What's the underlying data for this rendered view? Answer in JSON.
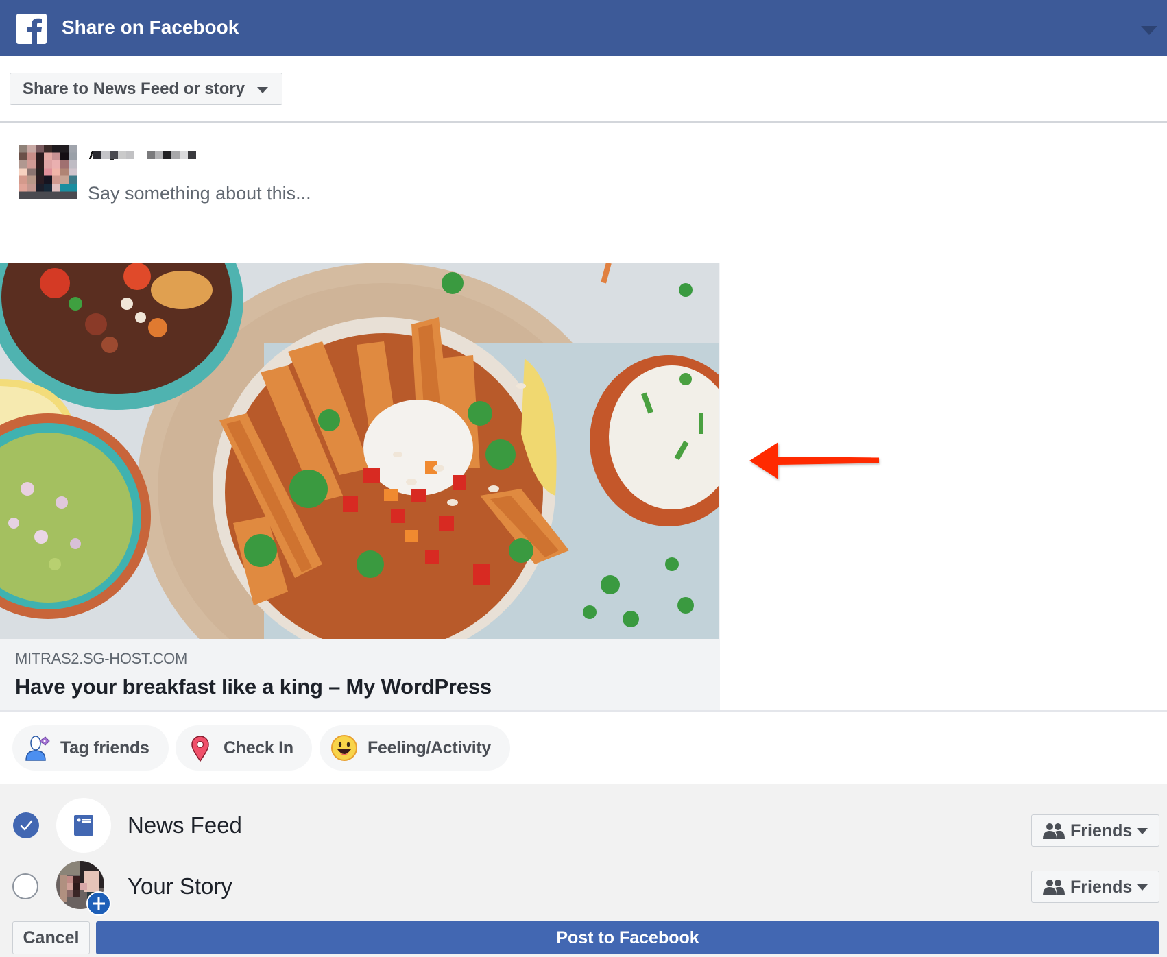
{
  "header": {
    "title": "Share on Facebook",
    "logo_icon": "facebook-logo-icon",
    "menu_icon": "chevron-down-icon",
    "brand_color": "#3d5a98"
  },
  "share_target": {
    "selected": "Share to News Feed or story"
  },
  "composer": {
    "user_name": "[pixelated name]",
    "placeholder": "Say something about this..."
  },
  "link_preview": {
    "domain": "MITRAS2.SG-HOST.COM",
    "title": "Have your breakfast like a king – My WordPress",
    "image_description": "Overhead photo of a bowl of sweet potato wedges with salsa, sour cream and herbs, surrounded by small bowls of guacamole, salad and dip"
  },
  "actions": [
    {
      "label": "Tag friends",
      "icon": "tag-friends-icon"
    },
    {
      "label": "Check In",
      "icon": "location-pin-icon"
    },
    {
      "label": "Feeling/Activity",
      "icon": "smiley-face-icon"
    }
  ],
  "destinations": [
    {
      "label": "News Feed",
      "checked": true,
      "audience": "Friends",
      "icon": "news-feed-icon"
    },
    {
      "label": "Your Story",
      "checked": false,
      "audience": "Friends",
      "icon": "story-avatar"
    }
  ],
  "footer": {
    "cancel_label": "Cancel",
    "post_label": "Post to Facebook",
    "post_color": "#4267b2"
  },
  "annotation": {
    "arrow_color": "#ff2a00",
    "arrow_direction": "left"
  }
}
